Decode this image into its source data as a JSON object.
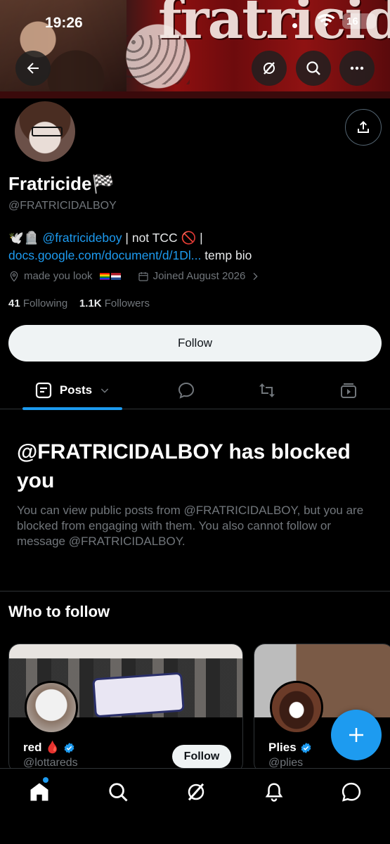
{
  "status_bar": {
    "time": "19:26",
    "battery": "16"
  },
  "banner": {
    "graffiti_text": "fratricide"
  },
  "profile": {
    "name": "Fratricide🏁",
    "handle": "@FRATRICIDALBOY",
    "bio": {
      "emoji_prefix": "🕊️🪦",
      "mention": "@fratricideboy",
      "text_mid": " | not TCC 🚫 | ",
      "link": "docs.google.com/document/d/1Dl...",
      "text_end": " temp bio"
    },
    "location": "made you look",
    "joined": "Joined August 2026",
    "following_count": "41",
    "following_label": "Following",
    "followers_count": "1.1K",
    "followers_label": "Followers"
  },
  "follow_button": "Follow",
  "tabs": {
    "posts": "Posts"
  },
  "blocked": {
    "title": "@FRATRICIDALBOY has blocked you",
    "text": "You can view public posts from @FRATRICIDALBOY, but you are blocked from engaging with them. You also cannot follow or message @FRATRICIDALBOY."
  },
  "who_to_follow": {
    "title": "Who to follow",
    "cards": [
      {
        "name": "red 🩸",
        "handle": "@lottareds",
        "follow": "Follow"
      },
      {
        "name": "Plies",
        "handle": "@plies"
      }
    ]
  },
  "colors": {
    "accent": "#1d9bf0",
    "background": "#000000",
    "muted": "#71767b"
  }
}
